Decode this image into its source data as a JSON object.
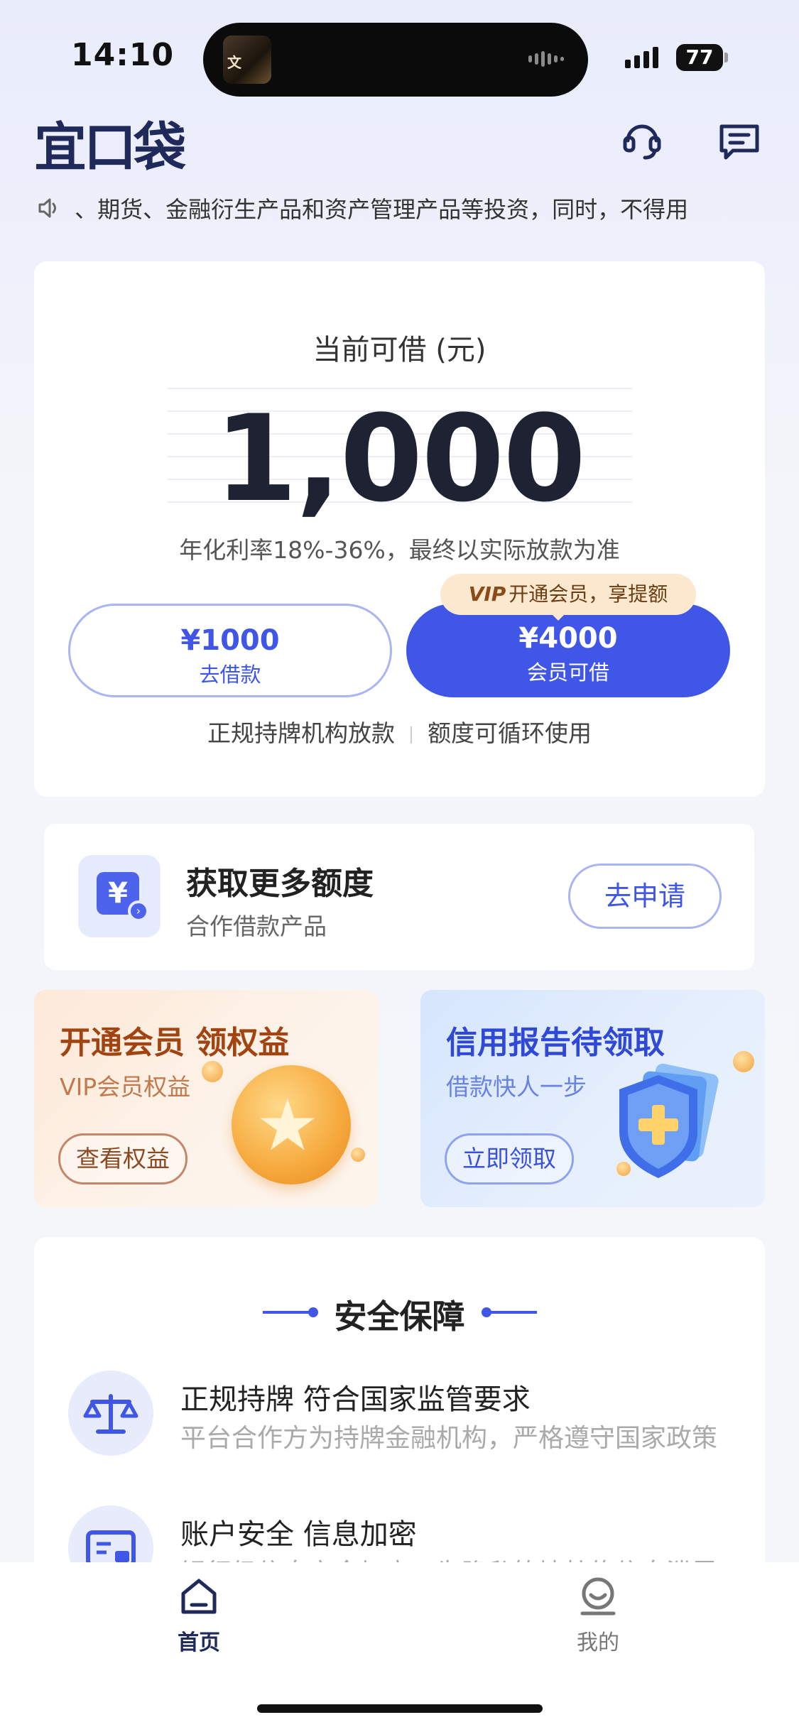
{
  "status_bar": {
    "time": "14:10",
    "battery": "77"
  },
  "header": {
    "logo": "宜口袋"
  },
  "notice": {
    "text": "、期货、金融衍生产品和资产管理产品等投资，同时，不得用"
  },
  "loan": {
    "label": "当前可借 (元)",
    "amount": "1,000",
    "rate_note": "年化利率18%-36%，最终以实际放款为准",
    "borrow_button": {
      "amount": "¥1000",
      "label": "去借款"
    },
    "vip_button": {
      "amount": "¥4000",
      "label": "会员可借"
    },
    "vip_tag": {
      "badge": "VIP",
      "text": "开通会员，享提额"
    },
    "features": [
      "正规持牌机构放款",
      "额度可循环使用"
    ]
  },
  "more_credit": {
    "icon_char": "¥",
    "title": "获取更多额度",
    "subtitle": "合作借款产品",
    "button": "去申请"
  },
  "promos": {
    "vip": {
      "title": "开通会员 领权益",
      "subtitle": "VIP会员权益",
      "button": "查看权益"
    },
    "credit": {
      "title": "信用报告待领取",
      "subtitle": "借款快人一步",
      "button": "立即领取"
    }
  },
  "security": {
    "title": "安全保障",
    "items": [
      {
        "title": "正规持牌 符合国家监管要求",
        "subtitle": "平台合作方为持牌金融机构，严格遵守国家政策"
      },
      {
        "title": "账户安全 信息加密",
        "subtitle": "银行级信息安全加密，为隐私筑墙杜绝信息泄露"
      }
    ]
  },
  "tabbar": {
    "home": "首页",
    "me": "我的"
  },
  "colors": {
    "primary": "#3f56e6",
    "vip_orange": "#a24412",
    "dark_text": "#1e2233"
  }
}
